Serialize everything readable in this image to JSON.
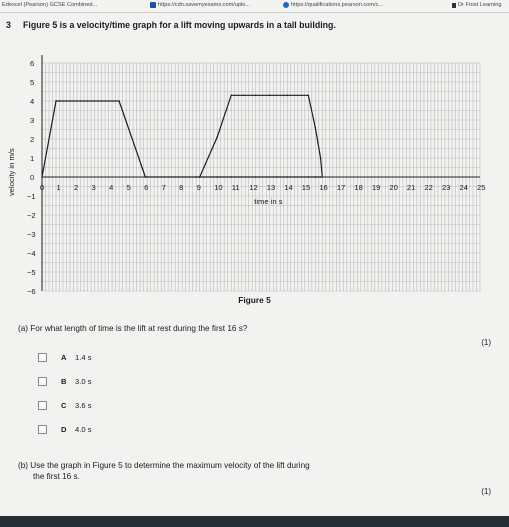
{
  "bookmarks": [
    {
      "label": "Edexcel (Pearson) GCSE Combined...",
      "icon": "none"
    },
    {
      "label": "https://cdn.savemyexams.com/uplo...",
      "icon": "savemyexams-icon"
    },
    {
      "label": "https://qualifications.pearson.com/c...",
      "icon": "pearson-icon"
    },
    {
      "label": "Dr Frost Learning",
      "icon": "drfrost-icon"
    }
  ],
  "question": {
    "number": "3",
    "text": "Figure 5 is a velocity/time graph for a lift moving upwards in a tall building."
  },
  "chart_data": {
    "type": "line",
    "xlabel": "time in s",
    "ylabel": "velocity in m/s",
    "xlim": [
      0,
      25
    ],
    "ylim": [
      -6,
      6
    ],
    "x_ticks": [
      "1",
      "2",
      "3",
      "4",
      "5",
      "6",
      "7",
      "8",
      "9",
      "10",
      "11",
      "12",
      "13",
      "14",
      "15",
      "16",
      "17",
      "18",
      "19",
      "20",
      "21",
      "22",
      "23",
      "24",
      "25"
    ],
    "y_ticks": [
      "6",
      "5",
      "4",
      "3",
      "2",
      "1",
      "0",
      "−1",
      "−2",
      "−3",
      "−4",
      "−5",
      "−6"
    ],
    "origin_label": "0",
    "grid": true,
    "series": [
      {
        "x": [
          0,
          0.8,
          4.4,
          5.9,
          6.0,
          8.8,
          9.0,
          10.0,
          10.8,
          12.2,
          13.4,
          14.0,
          15.2,
          15.6,
          15.9
        ],
        "y": [
          0,
          4.0,
          4.0,
          0,
          0,
          0,
          0,
          0,
          0,
          0,
          0,
          0,
          0,
          0,
          0
        ]
      },
      {
        "x": [
          9.0,
          10.0,
          10.8,
          11.5,
          12.2,
          13.0,
          14.0,
          15.2,
          15.6,
          15.9,
          16.0
        ],
        "y": [
          0,
          2.1,
          4.3,
          4.3,
          4.3,
          4.3,
          4.3,
          4.3,
          2.6,
          1.0,
          0
        ]
      }
    ]
  },
  "figure_caption": "Figure 5",
  "part_a": {
    "question": "(a)  For what length of time is the lift at rest during the first 16 s?",
    "marks": "(1)",
    "options": [
      {
        "letter": "A",
        "text": "1.4 s"
      },
      {
        "letter": "B",
        "text": "3.0 s"
      },
      {
        "letter": "C",
        "text": "3.6 s"
      },
      {
        "letter": "D",
        "text": "4.0 s"
      }
    ]
  },
  "part_b": {
    "question_line1": "(b)  Use the graph in Figure 5 to determine the maximum velocity of the lift during",
    "question_line2": "the first 16 s.",
    "marks": "(1)"
  }
}
